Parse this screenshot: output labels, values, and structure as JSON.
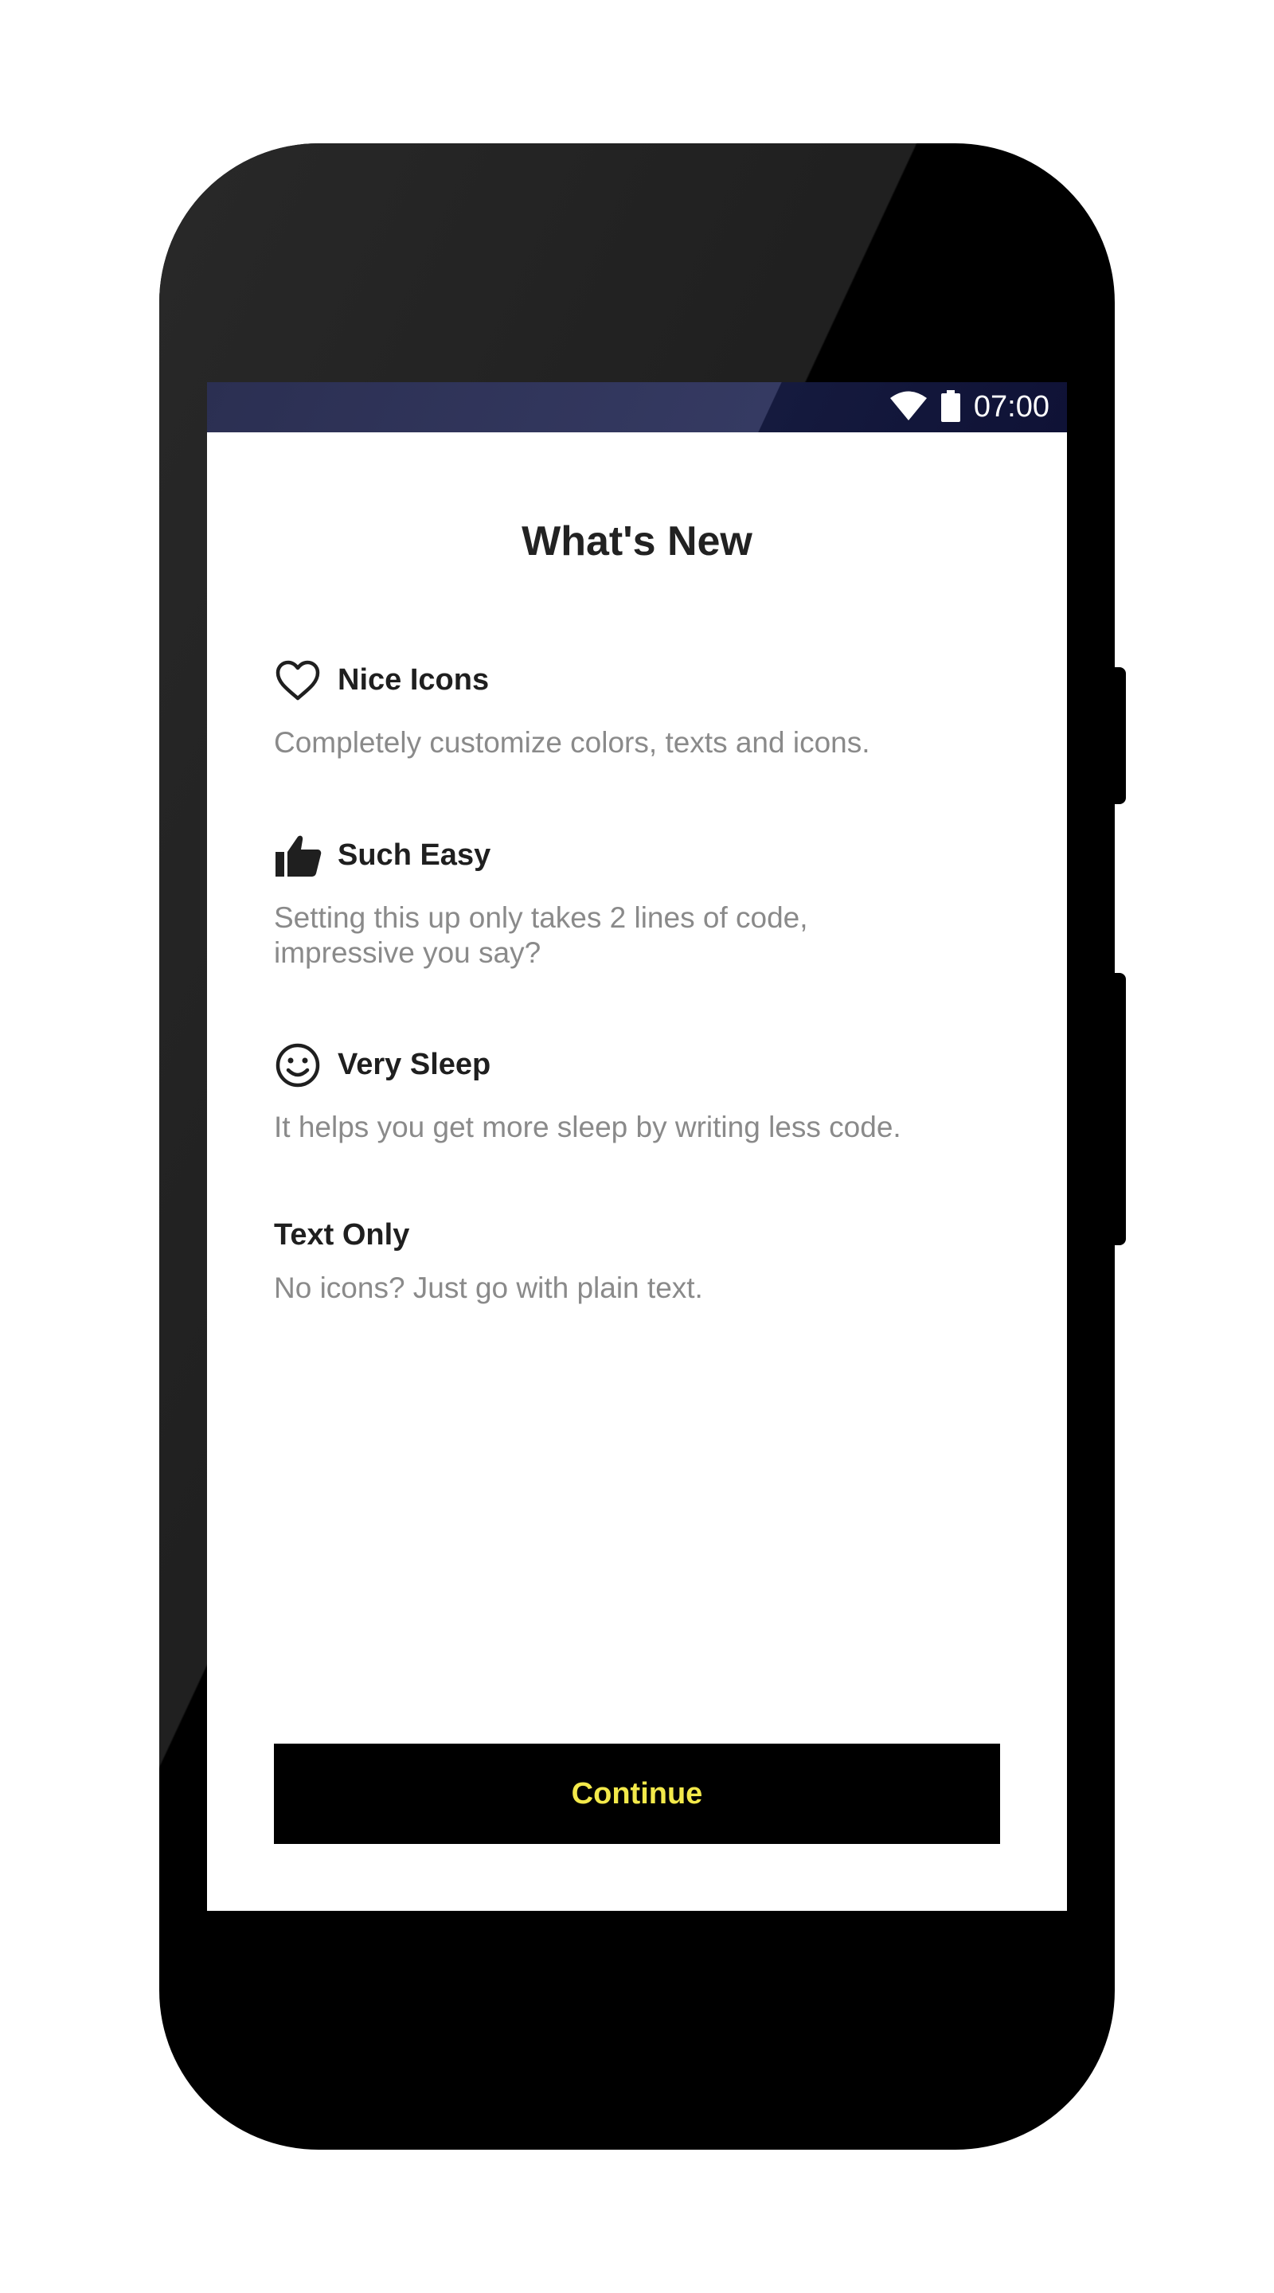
{
  "status_bar": {
    "time": "07:00",
    "wifi_icon": "wifi-icon",
    "battery_icon": "battery-icon"
  },
  "title": "What's New",
  "items": [
    {
      "icon": "heart-outline-icon",
      "title": "Nice Icons",
      "description": "Completely customize colors, texts and icons."
    },
    {
      "icon": "thumbs-up-icon",
      "title": "Such Easy",
      "description": "Setting this up only takes 2 lines of code, impressive you say?"
    },
    {
      "icon": "smiley-face-icon",
      "title": "Very Sleep",
      "description": "It helps you get more sleep by writing less code."
    },
    {
      "icon": "",
      "title": "Text Only",
      "description": "No icons? Just go with plain text."
    }
  ],
  "continue_button": {
    "label": "Continue"
  },
  "colors": {
    "button_background": "#000000",
    "button_text": "#f3e94a",
    "status_bar": "#2b2f52",
    "description_text": "#8a8a8a"
  }
}
